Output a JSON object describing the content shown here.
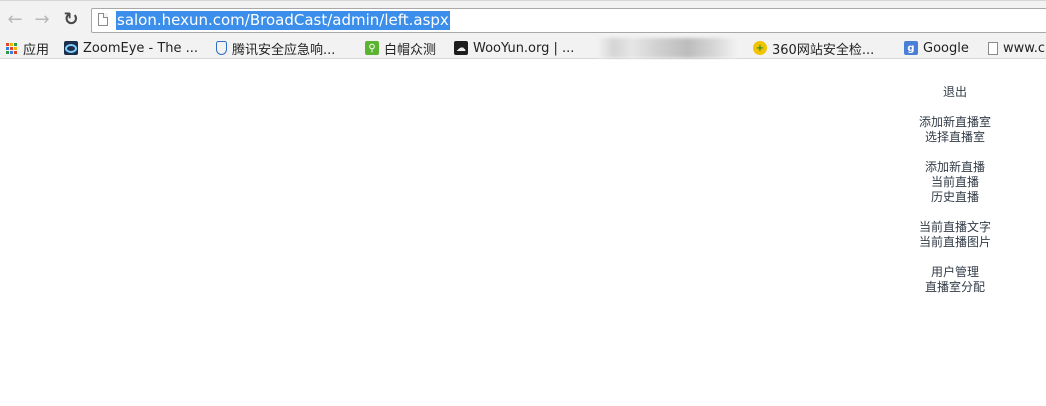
{
  "browser": {
    "url": "salon.hexun.com/BroadCast/admin/left.aspx",
    "bookmarks": [
      {
        "label": "应用",
        "icon": "apps-grid-icon"
      },
      {
        "label": "ZoomEye - The ...",
        "icon": "zoomeye-icon"
      },
      {
        "label": "腾讯安全应急响...",
        "icon": "tencent-shield-icon"
      },
      {
        "label": "白帽众测",
        "icon": "baimao-icon"
      },
      {
        "label": "WooYun.org | ...",
        "icon": "wooyun-icon"
      },
      {
        "label": "360网站安全检...",
        "icon": "360-icon"
      },
      {
        "label": "Google",
        "icon": "google-icon"
      },
      {
        "label": "www.c",
        "icon": "page-icon"
      }
    ]
  },
  "menu": {
    "groups": [
      [
        "退出"
      ],
      [
        "添加新直播室",
        "选择直播室"
      ],
      [
        "添加新直播",
        "当前直播",
        "历史直播"
      ],
      [
        "当前直播文字",
        "当前直播图片"
      ],
      [
        "用户管理",
        "直播室分配"
      ]
    ]
  },
  "colors": {
    "url_highlight": "#3b8eea",
    "menu_text": "#333c48",
    "toolbar_bg": "#f2f2f2"
  }
}
